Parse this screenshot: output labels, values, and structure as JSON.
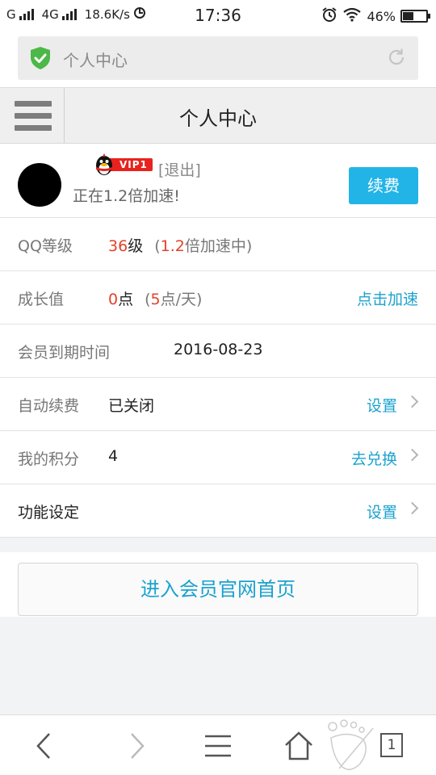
{
  "status_bar": {
    "carrier": "G",
    "network": "4G",
    "speed": "18.6K/s",
    "time": "17:36",
    "battery": "46%",
    "battery_level": 0.46,
    "icons": [
      "signal-icon",
      "data-saver-icon",
      "alarm-icon",
      "wifi-icon",
      "battery-icon"
    ]
  },
  "browser": {
    "url_text": "个人中心",
    "icons": [
      "shield-check-icon",
      "reload-icon"
    ],
    "accent_color": "#4cb847"
  },
  "header": {
    "title": "个人中心",
    "menu_icon": "hamburger-icon"
  },
  "profile": {
    "vip_badge": "VIP1",
    "logout": "[退出]",
    "speed_text": "正在1.2倍加速!",
    "renew_button": "续费",
    "renew_color": "#22b4e6"
  },
  "rows": {
    "qq_level": {
      "label": "QQ等级",
      "level": "36",
      "unit": "级",
      "open_paren": "(",
      "rate": "1.2",
      "rate_suffix": "倍加速中)"
    },
    "growth": {
      "label": "成长值",
      "points": "0",
      "unit": "点",
      "open_paren": "(",
      "daily": "5",
      "daily_suffix": "点/天)",
      "action": "点击加速"
    },
    "expiry": {
      "label": "会员到期时间",
      "value": "2016-08-23"
    },
    "auto_renew": {
      "label": "自动续费",
      "value": "已关闭",
      "action": "设置"
    },
    "points": {
      "label": "我的积分",
      "value": "4",
      "action": "去兑换"
    },
    "features": {
      "label": "功能设定",
      "action": "设置"
    }
  },
  "home_button": "进入会员官网首页",
  "bottom_nav": {
    "tab_count": "1",
    "icons": [
      "back-icon",
      "forward-icon",
      "menu-icon",
      "home-icon",
      "tabs-icon"
    ]
  },
  "colors": {
    "highlight_red": "#e0432a",
    "link_blue": "#1ba2cf"
  }
}
